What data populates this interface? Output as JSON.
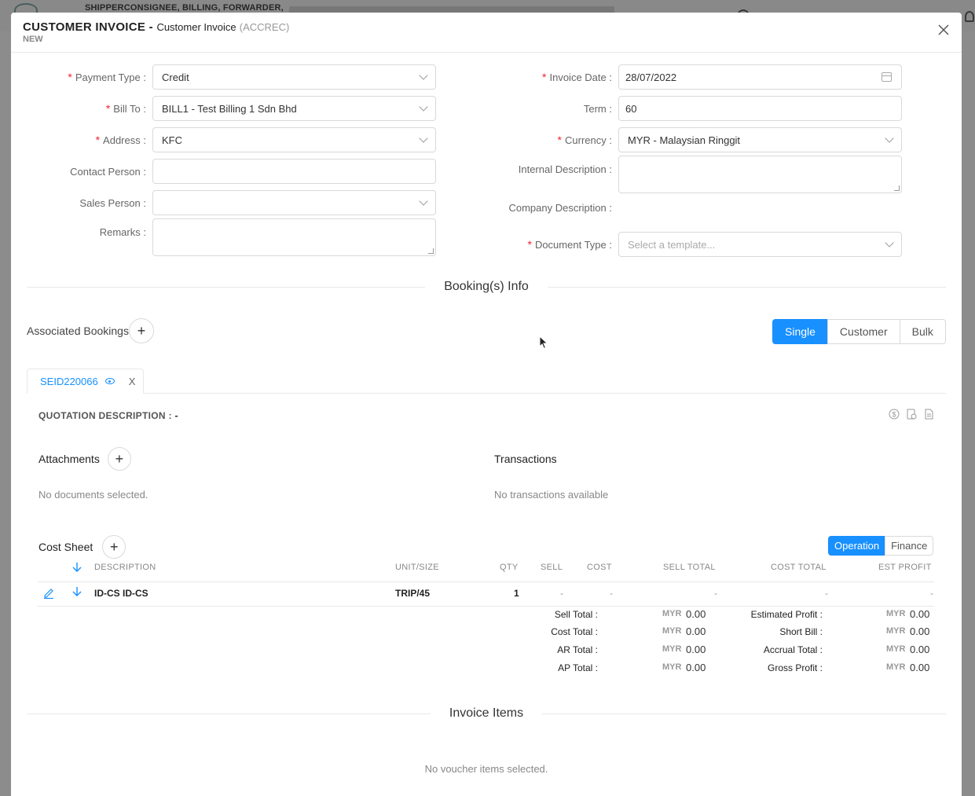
{
  "background": {
    "title": "SHIPPERCONSIGNEE, BILLING, FORWARDER,"
  },
  "modal": {
    "title_main": "CUSTOMER INVOICE - ",
    "title_type": "Customer Invoice",
    "title_code": "(ACCREC)",
    "status": "NEW",
    "close_label": "X"
  },
  "form": {
    "left": {
      "payment_type": {
        "label": "Payment Type",
        "value": "Credit"
      },
      "bill_to": {
        "label": "Bill To",
        "value": "BILL1 - Test Billing 1 Sdn Bhd"
      },
      "address": {
        "label": "Address",
        "value": "KFC"
      },
      "contact_person": {
        "label": "Contact Person",
        "value": ""
      },
      "sales_person": {
        "label": "Sales Person",
        "value": ""
      },
      "remarks": {
        "label": "Remarks",
        "value": ""
      }
    },
    "right": {
      "invoice_date": {
        "label": "Invoice Date",
        "value": "28/07/2022"
      },
      "term": {
        "label": "Term",
        "value": "60"
      },
      "currency": {
        "label": "Currency",
        "value": "MYR - Malaysian Ringgit"
      },
      "internal_description": {
        "label": "Internal Description",
        "value": ""
      },
      "company_description": {
        "label": "Company Description",
        "value": ""
      },
      "document_type": {
        "label": "Document Type",
        "placeholder": "Select a template..."
      }
    },
    "colon": ":"
  },
  "bookings": {
    "section_title": "Booking(s) Info",
    "associated_label": "Associated Bookings",
    "add_symbol": "+",
    "view_modes": [
      "Single",
      "Customer",
      "Bulk"
    ],
    "active_view": "Single",
    "tab": {
      "label": "SEID220066",
      "close": "X"
    },
    "quotation_label": "QUOTATION DESCRIPTION : ",
    "quotation_value": "-",
    "attachments_label": "Attachments",
    "attachments_empty": "No documents selected.",
    "transactions_label": "Transactions",
    "transactions_empty": "No transactions available"
  },
  "cost_sheet": {
    "title": "Cost Sheet",
    "modes": [
      "Operation",
      "Finance"
    ],
    "active_mode": "Operation",
    "columns": {
      "description": "DESCRIPTION",
      "unit_size": "UNIT/SIZE",
      "qty": "QTY",
      "sell": "SELL",
      "cost": "COST",
      "sell_total": "SELL TOTAL",
      "cost_total": "COST TOTAL",
      "est_profit": "EST PROFIT"
    },
    "rows": [
      {
        "description": "ID-CS ID-CS",
        "unit_size": "TRIP/45",
        "qty": "1",
        "sell": "-",
        "cost": "-",
        "sell_total": "-",
        "cost_total": "-",
        "est_profit": "-"
      }
    ],
    "totals_left": [
      {
        "label": "Sell Total :",
        "currency": "MYR",
        "value": "0.00"
      },
      {
        "label": "Cost Total :",
        "currency": "MYR",
        "value": "0.00"
      },
      {
        "label": "AR Total :",
        "currency": "MYR",
        "value": "0.00"
      },
      {
        "label": "AP Total :",
        "currency": "MYR",
        "value": "0.00"
      }
    ],
    "totals_right": [
      {
        "label": "Estimated Profit :",
        "currency": "MYR",
        "value": "0.00"
      },
      {
        "label": "Short Bill :",
        "currency": "MYR",
        "value": "0.00"
      },
      {
        "label": "Accrual Total :",
        "currency": "MYR",
        "value": "0.00"
      },
      {
        "label": "Gross Profit :",
        "currency": "MYR",
        "value": "0.00"
      }
    ]
  },
  "invoice_items": {
    "section_title": "Invoice Items",
    "empty": "No voucher items selected."
  },
  "colors": {
    "primary": "#1890ff",
    "required": "#f5222d"
  }
}
